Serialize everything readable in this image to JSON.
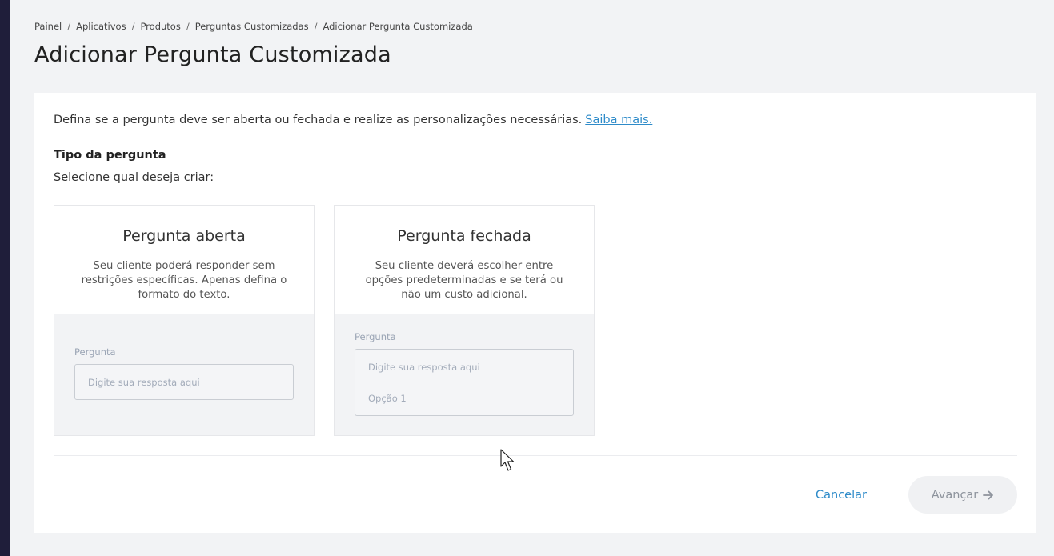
{
  "breadcrumb": [
    "Painel",
    "Aplicativos",
    "Produtos",
    "Perguntas Customizadas",
    "Adicionar Pergunta Customizada"
  ],
  "page_title": "Adicionar Pergunta Customizada",
  "intro": {
    "text": "Defina se a pergunta deve ser aberta ou fechada e realize as personalizações necessárias.",
    "link": "Saiba mais."
  },
  "question_type": {
    "title": "Tipo da pergunta",
    "subtitle": "Selecione qual deseja criar:"
  },
  "options": {
    "open": {
      "title": "Pergunta aberta",
      "description": "Seu cliente poderá responder sem restrições específicas. Apenas defina o formato do texto.",
      "preview_label": "Pergunta",
      "preview_placeholder": "Digite sua resposta aqui"
    },
    "closed": {
      "title": "Pergunta fechada",
      "description": "Seu cliente deverá escolher entre opções predeterminadas e se terá ou não um custo adicional.",
      "preview_label": "Pergunta",
      "preview_placeholder": "Digite sua resposta aqui",
      "preview_option": "Opção 1"
    }
  },
  "actions": {
    "cancel": "Cancelar",
    "next": "Avançar"
  },
  "icons": {
    "next": "arrow-right-icon",
    "cursor": "mouse-pointer-icon"
  },
  "colors": {
    "link": "#2e8bc9",
    "sidebar": "#1f1e3a",
    "background": "#f2f3f5",
    "disabled_button": "#f0f1f3"
  }
}
